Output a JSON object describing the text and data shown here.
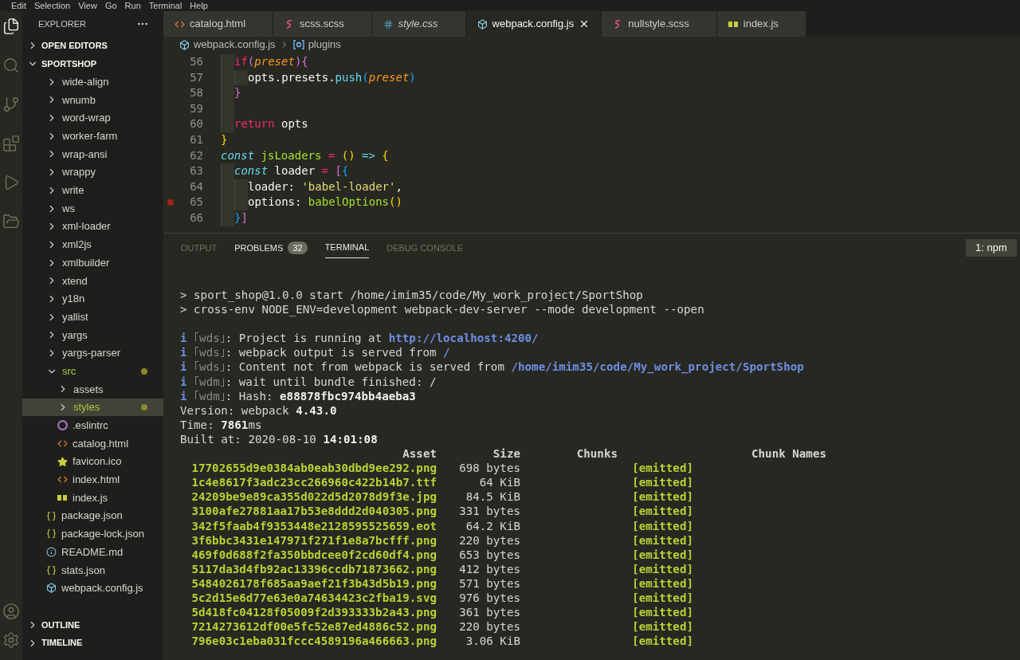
{
  "menu": [
    "Edit",
    "Selection",
    "View",
    "Go",
    "Run",
    "Terminal",
    "Help"
  ],
  "activity_bar": [
    {
      "kind": "files",
      "selected": true
    },
    {
      "kind": "search",
      "selected": false
    },
    {
      "kind": "git",
      "selected": false
    },
    {
      "kind": "extensions",
      "selected": false
    },
    {
      "kind": "run",
      "selected": false
    },
    {
      "kind": "folder",
      "selected": false
    }
  ],
  "activity_bottom": [
    {
      "kind": "account"
    },
    {
      "kind": "settings"
    }
  ],
  "sidebar": {
    "title": "EXPLORER",
    "sections_top": [
      {
        "label": "OPEN EDITORS",
        "expanded": false
      },
      {
        "label": "SPORTSHOP",
        "expanded": true
      }
    ],
    "items": [
      {
        "label": "wide-align",
        "kind": "folder",
        "expanded": false
      },
      {
        "label": "wnumb",
        "kind": "folder",
        "expanded": false
      },
      {
        "label": "word-wrap",
        "kind": "folder",
        "expanded": false
      },
      {
        "label": "worker-farm",
        "kind": "folder",
        "expanded": false
      },
      {
        "label": "wrap-ansi",
        "kind": "folder",
        "expanded": false
      },
      {
        "label": "wrappy",
        "kind": "folder",
        "expanded": false
      },
      {
        "label": "write",
        "kind": "folder",
        "expanded": false
      },
      {
        "label": "ws",
        "kind": "folder",
        "expanded": false
      },
      {
        "label": "xml-loader",
        "kind": "folder",
        "expanded": false
      },
      {
        "label": "xml2js",
        "kind": "folder",
        "expanded": false
      },
      {
        "label": "xmlbuilder",
        "kind": "folder",
        "expanded": false
      },
      {
        "label": "xtend",
        "kind": "folder",
        "expanded": false
      },
      {
        "label": "y18n",
        "kind": "folder",
        "expanded": false
      },
      {
        "label": "yallist",
        "kind": "folder",
        "expanded": false
      },
      {
        "label": "yargs",
        "kind": "folder",
        "expanded": false
      },
      {
        "label": "yargs-parser",
        "kind": "folder",
        "expanded": false
      },
      {
        "label": "src",
        "kind": "folder",
        "expanded": true,
        "modified": true,
        "selected": false,
        "children": [
          {
            "label": "assets",
            "kind": "folder",
            "expanded": false,
            "modified": false,
            "selected": false
          },
          {
            "label": "styles",
            "kind": "folder",
            "expanded": false,
            "modified": true,
            "selected": true
          },
          {
            "label": ".eslintrc",
            "kind": "eslint"
          },
          {
            "label": "catalog.html",
            "kind": "html"
          },
          {
            "label": "favicon.ico",
            "kind": "star"
          },
          {
            "label": "index.html",
            "kind": "html"
          },
          {
            "label": "index.js",
            "kind": "js"
          }
        ]
      },
      {
        "label": "package.json",
        "kind": "json"
      },
      {
        "label": "package-lock.json",
        "kind": "json"
      },
      {
        "label": "README.md",
        "kind": "info"
      },
      {
        "label": "stats.json",
        "kind": "json"
      },
      {
        "label": "webpack.config.js",
        "kind": "webpack"
      }
    ],
    "sections_bottom": [
      {
        "label": "OUTLINE",
        "expanded": false
      },
      {
        "label": "TIMELINE",
        "expanded": false
      }
    ]
  },
  "tabs": [
    {
      "label": "catalog.html",
      "kind": "html",
      "selected": false,
      "preview": false
    },
    {
      "label": "scss.scss",
      "kind": "scss",
      "selected": false,
      "preview": false
    },
    {
      "label": "style.css",
      "kind": "css",
      "selected": false,
      "preview": true
    },
    {
      "label": "webpack.config.js",
      "kind": "webpack",
      "selected": true,
      "preview": false
    },
    {
      "label": "nullstyle.scss",
      "kind": "scss",
      "selected": false,
      "preview": false
    },
    {
      "label": "index.js",
      "kind": "js",
      "selected": false,
      "preview": false
    }
  ],
  "breadcrumb": [
    {
      "label": "webpack.config.js",
      "kind": "webpack"
    },
    {
      "label": "plugins",
      "kind": "symbol"
    }
  ],
  "code": [
    {
      "children": [
        {
          "number": "56",
          "tokens": [
            {
              "text": "if",
              "kind": "keyword"
            },
            {
              "text": "(",
              "kind": "bracket2"
            },
            {
              "text": "preset",
              "kind": "param"
            },
            {
              "text": "){",
              "kind": "bracket2"
            }
          ],
          "children": [
            {
              "number": "57",
              "tokens": [
                {
                  "text": "opts.presets.",
                  "kind": "plain"
                },
                {
                  "text": "push",
                  "kind": "call"
                },
                {
                  "text": "(",
                  "kind": "bracket3"
                },
                {
                  "text": "preset",
                  "kind": "param"
                },
                {
                  "text": ")",
                  "kind": "bracket3"
                }
              ]
            }
          ]
        },
        {
          "number": "58",
          "tokens": [
            {
              "text": "}",
              "kind": "bracket2"
            }
          ]
        },
        {
          "number": "59"
        },
        {
          "number": "60",
          "tokens": [
            {
              "text": "return",
              "kind": "keyword"
            },
            {
              "text": " opts",
              "kind": "plain"
            }
          ]
        }
      ]
    },
    {
      "number": "61",
      "tokens": [
        {
          "text": "}",
          "kind": "bracket1"
        }
      ]
    },
    {
      "number": "62",
      "tokens": [
        {
          "text": "const ",
          "kind": "storage"
        },
        {
          "text": "jsLoaders",
          "kind": "funcname"
        },
        {
          "text": " = ",
          "kind": "operator"
        },
        {
          "text": "()",
          "kind": "bracket1"
        },
        {
          "text": " => ",
          "kind": "call"
        },
        {
          "text": "{",
          "kind": "bracket1"
        }
      ],
      "children": [
        {
          "number": "63",
          "tokens": [
            {
              "text": "const",
              "kind": "storage"
            },
            {
              "text": " loader ",
              "kind": "plain"
            },
            {
              "text": "= ",
              "kind": "operator"
            },
            {
              "text": "[",
              "kind": "bracket2"
            },
            {
              "text": "{",
              "kind": "bracket3"
            }
          ],
          "children": [
            {
              "number": "64",
              "tokens": [
                {
                  "text": "loader: ",
                  "kind": "plain"
                },
                {
                  "text": "'babel-loader'",
                  "kind": "string"
                },
                {
                  "text": ",",
                  "kind": "plain"
                }
              ]
            },
            {
              "number": "65",
              "breakpoint": true,
              "tokens": [
                {
                  "text": "options: ",
                  "kind": "plain"
                },
                {
                  "text": "babelOptions",
                  "kind": "funcname"
                },
                {
                  "text": "()",
                  "kind": "bracket1"
                }
              ]
            }
          ]
        },
        {
          "number": "66",
          "tokens": [
            {
              "text": "}",
              "kind": "bracket3"
            },
            {
              "text": "]",
              "kind": "bracket2"
            }
          ]
        }
      ]
    }
  ],
  "panel": {
    "tabs": [
      {
        "label": "OUTPUT",
        "selected": false
      },
      {
        "label": "PROBLEMS",
        "selected": false,
        "badge": "32"
      },
      {
        "label": "TERMINAL",
        "selected": true
      },
      {
        "label": "DEBUG CONSOLE",
        "selected": false
      }
    ],
    "terminal_select": "1: npm",
    "line_groups": [
      [
        [
          {
            "text": "> sport_shop@1.0.0 start /home/imim35/code/My_work_project/SportShop",
            "kind": "plain"
          }
        ],
        [
          {
            "text": "> cross-env NODE_ENV=development webpack-dev-server --mode development --open",
            "kind": "plain"
          }
        ]
      ],
      [
        [
          {
            "text": "i ",
            "kind": "info"
          },
          {
            "text": "｢wds｣",
            "kind": "dim"
          },
          {
            "text": ": Project is running at ",
            "kind": "plain"
          },
          {
            "text": "http://localhost:4200/",
            "kind": "link"
          }
        ],
        [
          {
            "text": "i ",
            "kind": "info"
          },
          {
            "text": "｢wds｣",
            "kind": "dim"
          },
          {
            "text": ": webpack output is served from ",
            "kind": "plain"
          },
          {
            "text": "/",
            "kind": "link"
          }
        ],
        [
          {
            "text": "i ",
            "kind": "info"
          },
          {
            "text": "｢wds｣",
            "kind": "dim"
          },
          {
            "text": ": Content not from webpack is served from ",
            "kind": "plain"
          },
          {
            "text": "/home/imim35/code/My_work_project/SportShop",
            "kind": "link"
          }
        ],
        [
          {
            "text": "i ",
            "kind": "info"
          },
          {
            "text": "｢wdm｣",
            "kind": "dim"
          },
          {
            "text": ": wait until bundle finished: /",
            "kind": "plain"
          }
        ],
        [
          {
            "text": "i ",
            "kind": "info"
          },
          {
            "text": "｢wdm｣",
            "kind": "dim"
          },
          {
            "text": ": Hash: ",
            "kind": "plain"
          },
          {
            "text": "e88878fbc974bb4aeba3",
            "kind": "bold"
          }
        ],
        [
          {
            "text": "Version: webpack ",
            "kind": "plain"
          },
          {
            "text": "4.43.0",
            "kind": "bold"
          }
        ],
        [
          {
            "text": "Time: ",
            "kind": "plain"
          },
          {
            "text": "7861",
            "kind": "bold"
          },
          {
            "text": "ms",
            "kind": "plain"
          }
        ],
        [
          {
            "text": "Built at: 2020-08-10 ",
            "kind": "plain"
          },
          {
            "text": "14:01:08",
            "kind": "bold"
          }
        ]
      ]
    ],
    "assets": {
      "columns": [
        "Asset",
        "Size",
        "Chunks",
        "Chunk Names"
      ],
      "rows": [
        {
          "asset": "17702655d9e0384ab0eab30dbd9ee292.png",
          "size": "698 bytes",
          "status": "[emitted]"
        },
        {
          "asset": "1c4e8617f3adc23cc266960c422b14b7.ttf",
          "size": "64 KiB",
          "status": "[emitted]"
        },
        {
          "asset": "24209be9e89ca355d022d5d2078d9f3e.jpg",
          "size": "84.5 KiB",
          "status": "[emitted]"
        },
        {
          "asset": "3100afe27881aa17b53e8ddd2d040305.png",
          "size": "331 bytes",
          "status": "[emitted]"
        },
        {
          "asset": "342f5faab4f9353448e2128595525659.eot",
          "size": "64.2 KiB",
          "status": "[emitted]"
        },
        {
          "asset": "3f6bbc3431e147971f271f1e8a7bcfff.png",
          "size": "220 bytes",
          "status": "[emitted]"
        },
        {
          "asset": "469f0d688f2fa350bbdcee0f2cd60df4.png",
          "size": "653 bytes",
          "status": "[emitted]"
        },
        {
          "asset": "5117da3d4fb92ac13396ccdb71873662.png",
          "size": "412 bytes",
          "status": "[emitted]"
        },
        {
          "asset": "5484026178f685aa9aef21f3b43d5b19.png",
          "size": "571 bytes",
          "status": "[emitted]"
        },
        {
          "asset": "5c2d15e6d77e63e0a74634423c2fba19.svg",
          "size": "976 bytes",
          "status": "[emitted]"
        },
        {
          "asset": "5d418fc04128f05009f2d393333b2a43.png",
          "size": "361 bytes",
          "status": "[emitted]"
        },
        {
          "asset": "7214273612df00e5fc52e87ed4886c52.png",
          "size": "220 bytes",
          "status": "[emitted]"
        },
        {
          "asset": "796e03c1eba031fccc4589196a466663.png",
          "size": "3.06 KiB",
          "status": "[emitted]"
        }
      ]
    }
  }
}
